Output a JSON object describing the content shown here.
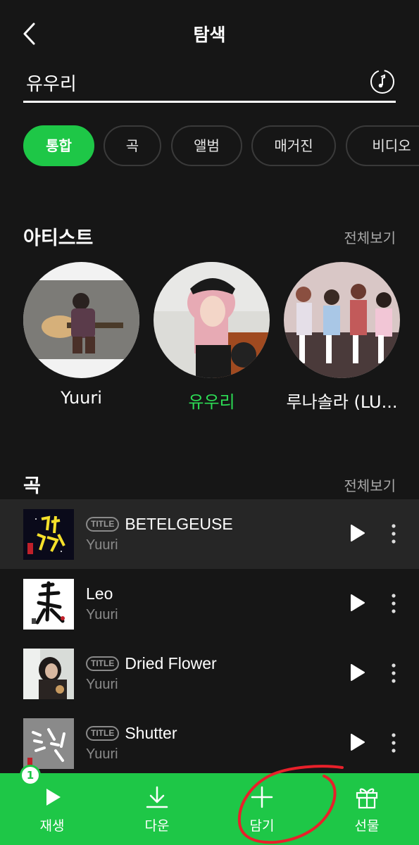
{
  "header": {
    "title": "탐색"
  },
  "search": {
    "value": "유우리"
  },
  "chips": [
    {
      "label": "통합",
      "active": true
    },
    {
      "label": "곡",
      "active": false
    },
    {
      "label": "앨범",
      "active": false
    },
    {
      "label": "매거진",
      "active": false
    },
    {
      "label": "비디오",
      "active": false
    }
  ],
  "artists_section": {
    "title": "아티스트",
    "see_all": "전체보기",
    "items": [
      {
        "name": "Yuuri"
      },
      {
        "name": "유우리"
      },
      {
        "name": "루나솔라 (LU..."
      }
    ]
  },
  "songs_section": {
    "title": "곡",
    "see_all": "전체보기",
    "items": [
      {
        "badge": "TITLE",
        "title": "BETELGEUSE",
        "artist": "Yuuri",
        "highlighted": true
      },
      {
        "badge": "",
        "title": "Leo",
        "artist": "Yuuri",
        "highlighted": false
      },
      {
        "badge": "TITLE",
        "title": "Dried Flower",
        "artist": "Yuuri",
        "highlighted": false
      },
      {
        "badge": "TITLE",
        "title": "Shutter",
        "artist": "Yuuri",
        "highlighted": false
      }
    ]
  },
  "bottom_bar": {
    "count": "1",
    "items": [
      {
        "label": "재생",
        "icon": "play-icon"
      },
      {
        "label": "다운",
        "icon": "download-icon"
      },
      {
        "label": "담기",
        "icon": "plus-icon"
      },
      {
        "label": "선물",
        "icon": "gift-icon"
      }
    ]
  },
  "colors": {
    "accent": "#1ec747",
    "background": "#161616",
    "annotation": "#e8202a"
  }
}
